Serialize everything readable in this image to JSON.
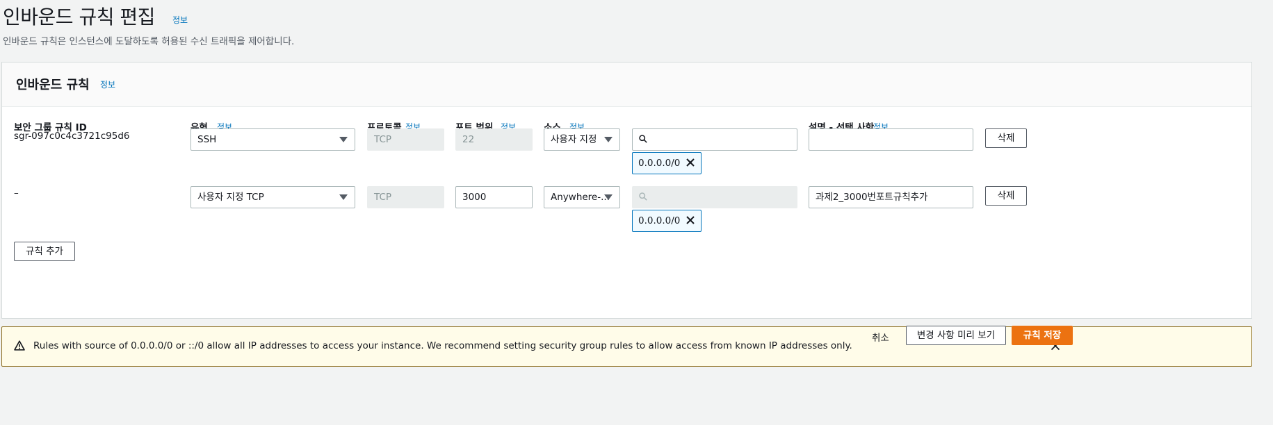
{
  "page": {
    "title": "인바운드 규칙 편집",
    "title_info": "정보",
    "description": "인바운드 규칙은 인스턴스에 도달하도록 허용된 수신 트래픽을 제어합니다."
  },
  "panel": {
    "title": "인바운드 규칙",
    "title_info": "정보",
    "columns": {
      "rule_id": "보안 그룹 규칙 ID",
      "type": "유형",
      "type_info": "정보",
      "protocol": "프로토콜",
      "protocol_info": "정보",
      "port_range": "포트 범위",
      "port_range_info": "정보",
      "source": "소스",
      "source_info": "정보",
      "description": "설명 - 선택 사항",
      "description_info": "정보"
    },
    "rules": [
      {
        "rule_id": "sgr-097c0c4c3721c95d6",
        "type": "SSH",
        "protocol": "TCP",
        "port_range": "22",
        "source_type": "사용자 지정",
        "source_search": "",
        "source_chip": "0.0.0.0/0",
        "description": "",
        "delete_label": "삭제"
      },
      {
        "rule_id": "–",
        "type": "사용자 지정 TCP",
        "protocol": "TCP",
        "port_range": "3000",
        "source_type": "Anywhere-...",
        "source_search": "",
        "source_chip": "0.0.0.0/0",
        "description": "과제2_3000번포트규칙추가",
        "delete_label": "삭제"
      }
    ],
    "add_rule_label": "규칙 추가"
  },
  "warning": {
    "text": "Rules with source of 0.0.0.0/0 or ::/0 allow all IP addresses to access your instance. We recommend setting security group rules to allow access from known IP addresses only."
  },
  "footer": {
    "cancel_label": "취소",
    "preview_label": "변경 사항 미리 보기",
    "save_label": "규칙 저장"
  },
  "colors": {
    "primary": "#ec7211",
    "link": "#0073bb",
    "warning_bg": "#fffce9",
    "warning_border": "#8c6d1f"
  }
}
